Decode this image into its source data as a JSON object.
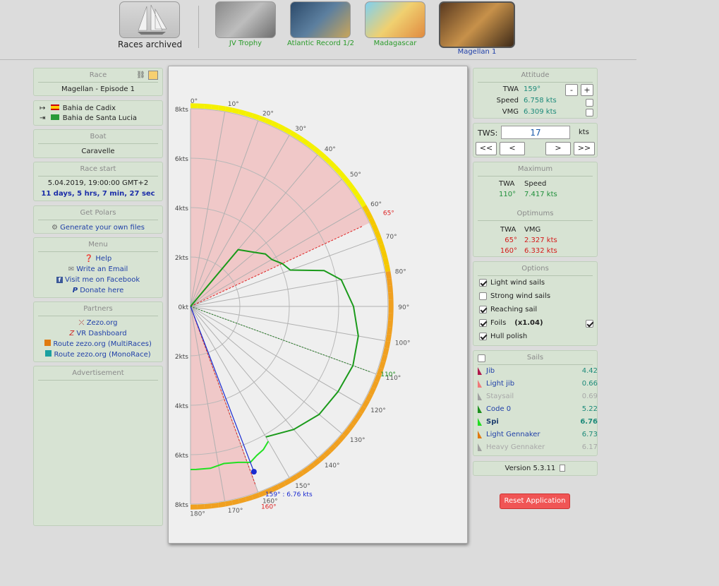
{
  "header": {
    "archived_label": "Races archived",
    "races": [
      {
        "label": "JV Trophy",
        "color": "#2a9b2a"
      },
      {
        "label": "Atlantic Record 1/2",
        "color": "#2a9b2a"
      },
      {
        "label": "Madagascar",
        "color": "#2a9b2a"
      },
      {
        "label": "Magellan 1",
        "color": "#1f3fa8"
      }
    ]
  },
  "race": {
    "title": "Race",
    "name": "Magellan - Episode 1",
    "start_port": "Bahia de Cadix",
    "end_port": "Bahia de Santa Lucia"
  },
  "boat": {
    "title": "Boat",
    "name": "Caravelle"
  },
  "race_start": {
    "title": "Race start",
    "date": "5.04.2019, 19:00:00 GMT+2",
    "elapsed": "11 days, 5 hrs, 7 min, 27 sec"
  },
  "polars": {
    "title": "Get Polars",
    "link": "Generate your own files"
  },
  "menu": {
    "title": "Menu",
    "items": [
      "Help",
      "Write an Email",
      "Visit me on Facebook",
      "Donate here"
    ]
  },
  "partners": {
    "title": "Partners",
    "items": [
      "Zezo.org",
      "VR Dashboard",
      "Route zezo.org (MultiRaces)",
      "Route zezo.org (MonoRace)"
    ]
  },
  "advertisement": {
    "title": "Advertisement"
  },
  "attitude": {
    "title": "Attitude",
    "twa_label": "TWA",
    "twa_value": "159°",
    "speed_label": "Speed",
    "speed_value": "6.758 kts",
    "vmg_label": "VMG",
    "vmg_value": "6.309 kts",
    "minus": "-",
    "plus": "+"
  },
  "tws": {
    "label": "TWS:",
    "value": "17",
    "unit": "kts",
    "buttons": [
      "<<",
      "<",
      ">",
      ">>"
    ]
  },
  "maximum": {
    "title": "Maximum",
    "twa_label": "TWA",
    "speed_label": "Speed",
    "twa": "110°",
    "speed": "7.417 kts"
  },
  "optimums": {
    "title": "Optimums",
    "twa_label": "TWA",
    "vmg_label": "VMG",
    "rows": [
      {
        "twa": "65°",
        "vmg": "2.327 kts"
      },
      {
        "twa": "160°",
        "vmg": "6.332 kts"
      }
    ]
  },
  "options": {
    "title": "Options",
    "items": [
      {
        "label": "Light wind sails",
        "checked": true
      },
      {
        "label": "Strong wind sails",
        "checked": false
      },
      {
        "label": "Reaching sail",
        "checked": true
      },
      {
        "label": "Foils",
        "extra": "(x1.04)",
        "checked": true
      },
      {
        "label": "Hull polish",
        "checked": true
      }
    ]
  },
  "sails": {
    "title": "Sails",
    "items": [
      {
        "name": "Jib",
        "value": "4.42",
        "color": "#b0184a",
        "bold": false,
        "dim": false
      },
      {
        "name": "Light jib",
        "value": "0.66",
        "color": "#f07a7a",
        "bold": false,
        "dim": false
      },
      {
        "name": "Staysail",
        "value": "0.69",
        "color": "#a0a0a0",
        "bold": false,
        "dim": true
      },
      {
        "name": "Code 0",
        "value": "5.22",
        "color": "#1f8f1f",
        "bold": false,
        "dim": false
      },
      {
        "name": "Spi",
        "value": "6.76",
        "color": "#22dd22",
        "bold": true,
        "dim": false
      },
      {
        "name": "Light Gennaker",
        "value": "6.73",
        "color": "#e07a10",
        "bold": false,
        "dim": false
      },
      {
        "name": "Heavy Gennaker",
        "value": "6.17",
        "color": "#a0a0a0",
        "bold": false,
        "dim": true
      }
    ]
  },
  "version": "Version 5.3.11",
  "reset_label": "Reset Application",
  "chart_data": {
    "type": "polar",
    "radial_unit": "kts",
    "rmax": 8,
    "radial_ticks": [
      "0kt",
      "2kts",
      "4kts",
      "6kts",
      "8kts"
    ],
    "angle_ticks": [
      "0°",
      "10°",
      "20°",
      "30°",
      "40°",
      "50°",
      "60°",
      "70°",
      "80°",
      "90°",
      "100°",
      "110°",
      "120°",
      "130°",
      "140°",
      "150°",
      "160°",
      "170°",
      "180°"
    ],
    "no_go_zones_twa": [
      [
        0,
        65
      ],
      [
        160,
        180
      ]
    ],
    "polar_series": [
      {
        "name": "Code 0",
        "color": "#1a9a1a",
        "points": [
          [
            0,
            0
          ],
          [
            40,
            3.0
          ],
          [
            50,
            3.4
          ],
          [
            55,
            3.7
          ],
          [
            60,
            3.8
          ],
          [
            65,
            4.1
          ],
          [
            70,
            4.3
          ],
          [
            75,
            5.6
          ],
          [
            80,
            6.2
          ],
          [
            90,
            6.6
          ],
          [
            100,
            6.9
          ],
          [
            110,
            7.0
          ],
          [
            120,
            6.9
          ],
          [
            130,
            6.8
          ],
          [
            140,
            6.5
          ],
          [
            150,
            6.1
          ]
        ]
      },
      {
        "name": "Spi",
        "color": "#22e022",
        "points": [
          [
            150,
            6.3
          ],
          [
            153,
            6.5
          ],
          [
            156,
            6.6
          ],
          [
            159,
            6.76
          ],
          [
            163,
            6.6
          ],
          [
            168,
            6.5
          ],
          [
            173,
            6.6
          ],
          [
            178,
            6.6
          ],
          [
            180,
            6.6
          ]
        ]
      }
    ],
    "markers": {
      "optimum_upwind": {
        "twa": 65,
        "label": "65°"
      },
      "optimum_downwind": {
        "twa": 160,
        "label": "160°"
      },
      "maximum": {
        "twa": 110,
        "label": "110°"
      },
      "current": {
        "twa": 159,
        "speed": 6.76,
        "label": "159° : 6.76 kts"
      }
    }
  }
}
